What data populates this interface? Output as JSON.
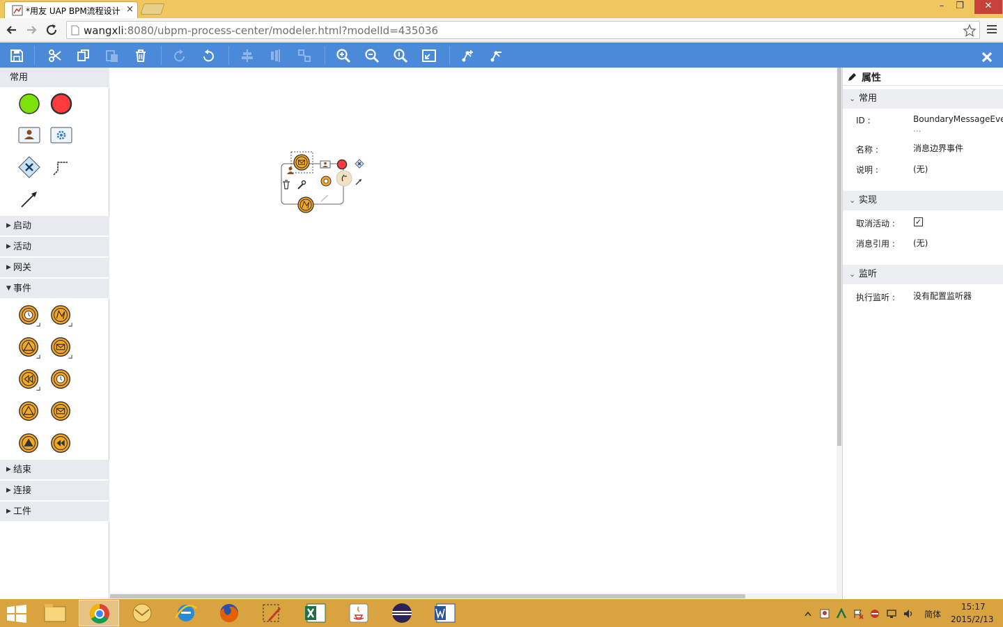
{
  "browser": {
    "tab_title": "*用友 UAP BPM流程设计",
    "tab_close": "×",
    "url_host": "wangxli",
    "url_rest": ":8080/ubpm-process-center/modeler.html?modelId=435036",
    "window_controls": [
      "–",
      "❐",
      "✕"
    ]
  },
  "colors": {
    "toolbar": "#4a8ad9",
    "title_bar": "#f0c75e",
    "taskbar": "#d9a43f",
    "event_orange": "#f5a623",
    "start_green": "#7ce00a",
    "end_red": "#ff3b3b"
  },
  "toolbar": {
    "buttons": [
      "save-icon",
      "cut-icon",
      "copy-icon",
      "paste-icon",
      "delete-icon",
      "redo-icon",
      "undo-icon",
      "align-horizontal-icon",
      "align-vertical-icon",
      "same-size-icon",
      "zoom-in-icon",
      "zoom-out-icon",
      "zoom-actual-icon",
      "zoom-fit-icon",
      "bend-point-add-icon",
      "bend-point-remove-icon",
      "close-icon"
    ]
  },
  "palette": {
    "common_label": "常用",
    "groups": [
      {
        "label": "启动",
        "expanded": false
      },
      {
        "label": "活动",
        "expanded": false
      },
      {
        "label": "网关",
        "expanded": false
      },
      {
        "label": "事件",
        "expanded": true
      },
      {
        "label": "结束",
        "expanded": false
      },
      {
        "label": "连接",
        "expanded": false
      },
      {
        "label": "工件",
        "expanded": false
      }
    ]
  },
  "properties": {
    "title": "属性",
    "section_common": "常用",
    "id_label": "ID :",
    "id_value": "BoundaryMessageEve",
    "id_more": "...",
    "name_label": "名称 :",
    "name_value": "消息边界事件",
    "desc_label": "说明 :",
    "desc_value": "(无)",
    "section_impl": "实现",
    "cancel_label": "取消活动 :",
    "cancel_checked": true,
    "cancel_check": "✓",
    "msgref_label": "消息引用 :",
    "msgref_value": "(无)",
    "section_listen": "监听",
    "exec_label": "执行监听 :",
    "exec_value": "没有配置监听器"
  },
  "taskbar": {
    "lang": "简体",
    "time": "15:17",
    "date": "2015/2/13"
  }
}
